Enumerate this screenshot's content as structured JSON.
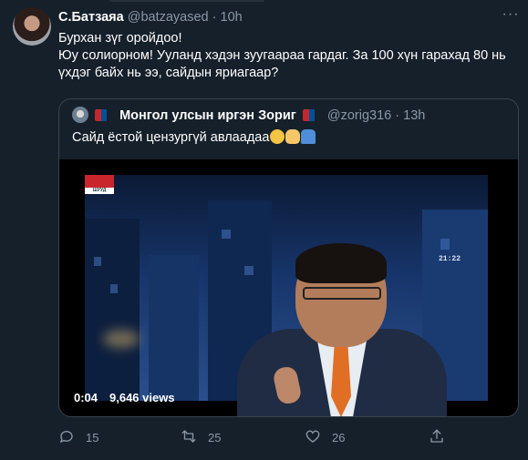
{
  "tweet": {
    "author_name": "С.Батзаяа",
    "handle": "@batzayased",
    "separator": " · ",
    "time": "10h",
    "lines": [
      "Бурхан зүг оройдоо!",
      "Юу солиорном! Ууланд хэдэн зуугаараа гардаг. За 100 хүн гарахад 80 нь үхдэг байх нь ээ, сайдын яриагаар?"
    ]
  },
  "quoted": {
    "author_name": "Монгол улсын иргэн Зориг",
    "handle": "@zorig316",
    "separator": " · ",
    "time": "13h",
    "text": "Сайд ёстой цензургүй авлаадаа",
    "flag_colors": [
      "#c4272f",
      "#015197",
      "#c4272f"
    ]
  },
  "video": {
    "elapsed": "0:04",
    "views": "9,646 views",
    "clock": "21:22",
    "channel_logo_caption": "ШУУД"
  },
  "actions": {
    "replies": "15",
    "retweets": "25",
    "likes": "26"
  },
  "colors": {
    "background": "#15202b",
    "secondary_text": "#8b98a5",
    "border": "#38444d"
  }
}
